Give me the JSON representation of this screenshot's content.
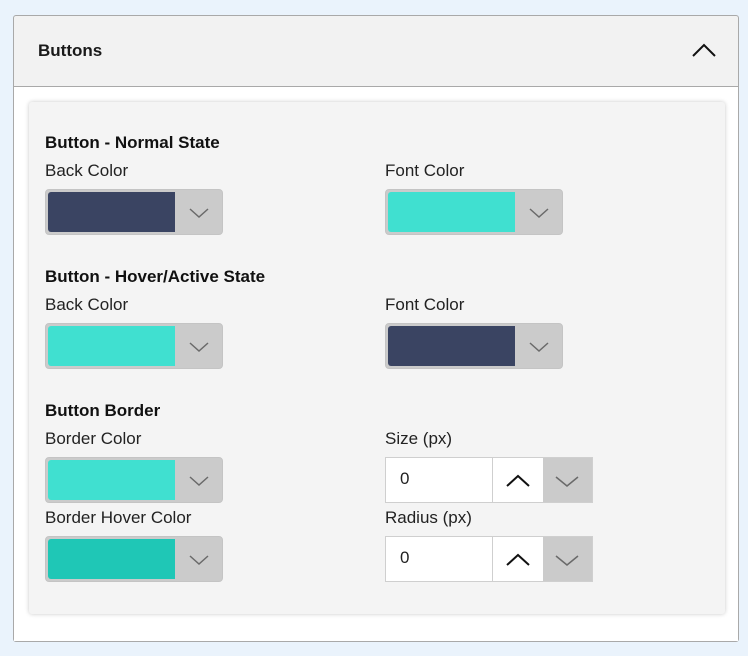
{
  "accordion": {
    "title": "Buttons"
  },
  "sections": {
    "normal": {
      "title": "Button - Normal State",
      "back_label": "Back Color",
      "back_color": "#3a4462",
      "font_label": "Font Color",
      "font_color": "#40e0d0"
    },
    "hover": {
      "title": "Button - Hover/Active State",
      "back_label": "Back Color",
      "back_color": "#40e0d0",
      "font_label": "Font Color",
      "font_color": "#3a4462"
    },
    "border": {
      "title": "Button Border",
      "color_label": "Border Color",
      "color": "#40e0d0",
      "hover_label": "Border Hover Color",
      "hover_color": "#1fc7b6",
      "size_label": "Size (px)",
      "size_value": "0",
      "radius_label": "Radius (px)",
      "radius_value": "0"
    }
  },
  "icons": {
    "collapse": "chevron-up-icon",
    "dropdown": "chevron-down-icon",
    "increment": "chevron-up-icon",
    "decrement": "chevron-down-icon"
  }
}
